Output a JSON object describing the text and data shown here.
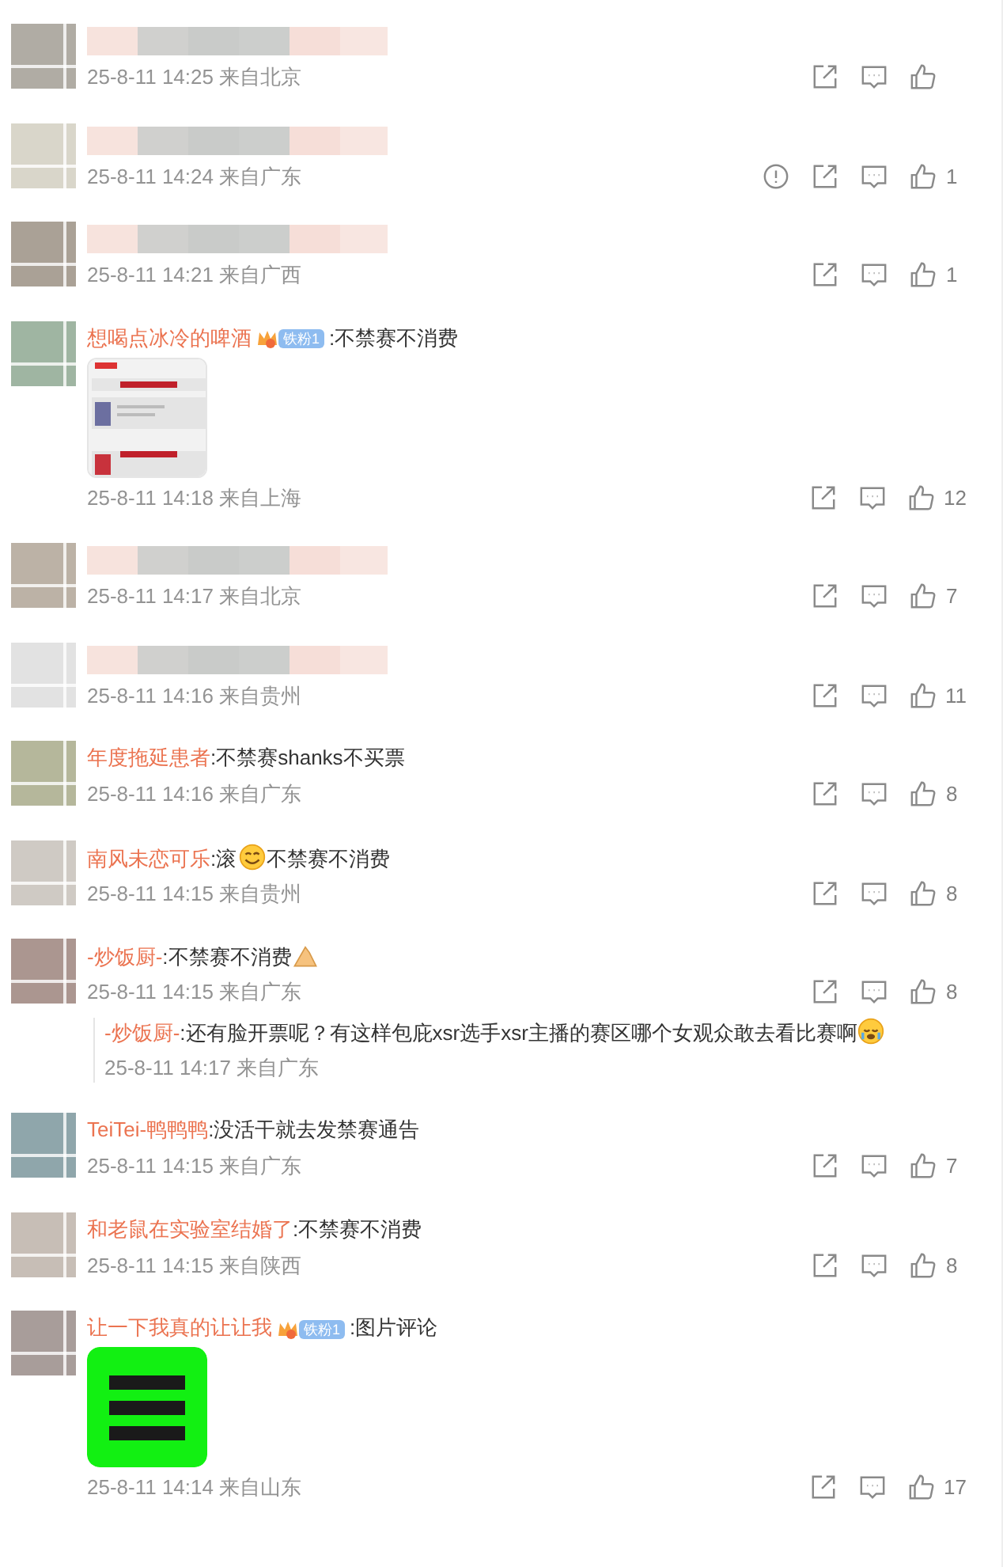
{
  "comments": [
    {
      "color": "#b0aca4",
      "kind": "hidden",
      "time": "25-8-11 14:25",
      "location": "来自北京",
      "report": false
    },
    {
      "color": "#d9d6ca",
      "kind": "hidden",
      "time": "25-8-11 14:24",
      "location": "来自广东",
      "report": true,
      "likes": "1"
    },
    {
      "color": "#aaa196",
      "kind": "hidden",
      "time": "25-8-11 14:21",
      "location": "来自广西",
      "report": false,
      "likes": "1"
    },
    {
      "color": "#9fb5a2",
      "kind": "named",
      "name": "想喝点冰冷的啤酒",
      "badge": "铁粉1",
      "parts": [
        {
          "kind": "text",
          "text": ":不禁赛不消费"
        }
      ],
      "image": {
        "kind": "picture"
      },
      "time": "25-8-11 14:18",
      "location": "来自上海",
      "report": false,
      "likes": "12"
    },
    {
      "color": "#bcb2a6",
      "kind": "hidden",
      "time": "25-8-11 14:17",
      "location": "来自北京",
      "report": false,
      "likes": "7"
    },
    {
      "color": "#e2e2e2",
      "kind": "hidden",
      "time": "25-8-11 14:16",
      "location": "来自贵州",
      "report": false,
      "likes": "11"
    },
    {
      "color": "#b5b79b",
      "kind": "named",
      "name": "年度拖延患者",
      "parts": [
        {
          "kind": "text",
          "text": ":不禁赛shanks不买票"
        }
      ],
      "time": "25-8-11 14:16",
      "location": "来自广东",
      "report": false,
      "likes": "8"
    },
    {
      "color": "#cfcac4",
      "kind": "named",
      "name": "南风未恋可乐",
      "parts": [
        {
          "kind": "text",
          "text": ":滚"
        },
        {
          "kind": "smile"
        },
        {
          "kind": "text",
          "text": "不禁赛不消费"
        }
      ],
      "time": "25-8-11 14:15",
      "location": "来自贵州",
      "report": false,
      "likes": "8"
    },
    {
      "color": "#ab9690",
      "kind": "named",
      "name": "-炒饭厨-",
      "parts": [
        {
          "kind": "text",
          "text": ":不禁赛不消费"
        },
        {
          "kind": "pray"
        }
      ],
      "time": "25-8-11 14:15",
      "location": "来自广东",
      "report": false,
      "likes": "8",
      "replies": [
        {
          "name": "-炒饭厨-",
          "parts": [
            {
              "kind": "text",
              "text": ":还有脸开票呢？有这样包庇xsr选手xsr主播的赛区哪个女观众敢去看比赛啊"
            },
            {
              "kind": "cry"
            }
          ],
          "time": "25-8-11 14:17",
          "location": "来自广东"
        }
      ]
    },
    {
      "color": "#8fa6ab",
      "kind": "named",
      "name": "TeiTei-鸭鸭鸭",
      "parts": [
        {
          "kind": "text",
          "text": ":没活干就去发禁赛通告"
        }
      ],
      "time": "25-8-11 14:15",
      "location": "来自广东",
      "report": false,
      "likes": "7"
    },
    {
      "color": "#c7beb6",
      "kind": "named",
      "name": "和老鼠在实验室结婚了",
      "parts": [
        {
          "kind": "text",
          "text": ":不禁赛不消费"
        }
      ],
      "time": "25-8-11 14:15",
      "location": "来自陕西",
      "report": false,
      "likes": "8"
    },
    {
      "color": "#a89d9a",
      "kind": "named",
      "name": "让一下我真的让让我",
      "badge": "铁粉1",
      "parts": [
        {
          "kind": "text",
          "text": ":图片评论"
        }
      ],
      "image": {
        "kind": "picture"
      },
      "time": "25-8-11 14:14",
      "location": "来自山东",
      "report": false,
      "likes": "17"
    }
  ]
}
